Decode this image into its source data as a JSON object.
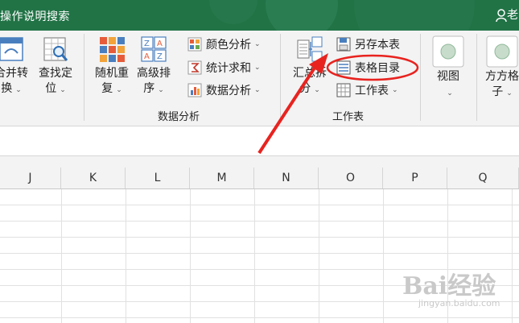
{
  "titlebar": {
    "title": "操作说明搜索",
    "user_glyph": "♀",
    "user_text": "老"
  },
  "ribbon": {
    "group1": {
      "btn1_label": "合并转",
      "btn1_sub": "换",
      "btn2_label": "查找定",
      "btn2_sub": "位"
    },
    "group2": {
      "label": "数据分析",
      "random_label": "随机重",
      "random_sub": "复",
      "sort_label": "高级排",
      "sort_sub": "序",
      "color_analysis": "颜色分析",
      "sum_count": "统计求和",
      "data_analysis": "数据分析"
    },
    "group3": {
      "label": "工作表",
      "summary_label": "汇总拆",
      "summary_sub": "分",
      "save_as_sheet": "另存本表",
      "table_catalog": "表格目录",
      "worksheet": "工作表"
    },
    "group4": {
      "view_label": "视图"
    },
    "group5": {
      "square_label": "方方格",
      "square_sub": "子"
    }
  },
  "columns": [
    "J",
    "K",
    "L",
    "M",
    "N",
    "O",
    "P",
    "Q"
  ],
  "watermark": {
    "text": "Bai经验",
    "sub": "jingyan.baidu.com"
  },
  "colors": {
    "excel_green": "#217346",
    "annotation_red": "#e8231f"
  }
}
